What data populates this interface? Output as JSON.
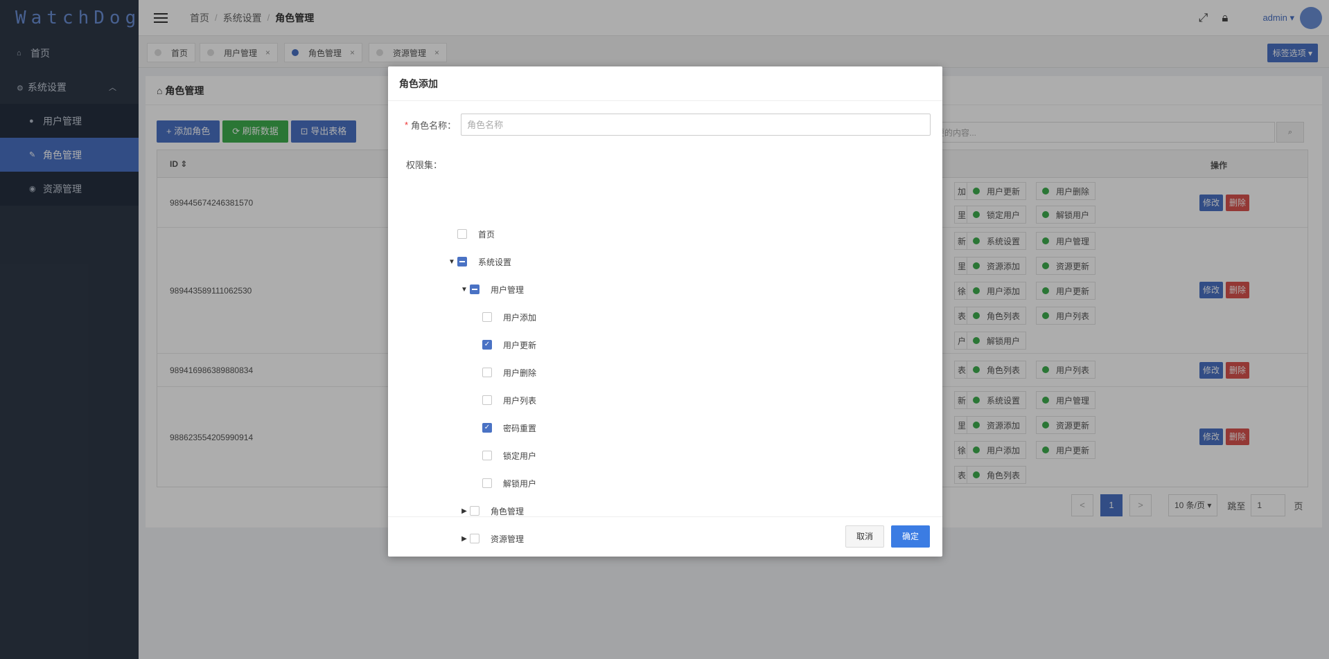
{
  "app": {
    "logo_text": "WatchDog"
  },
  "sidebar": {
    "items": [
      {
        "label": "首页"
      },
      {
        "label": "系统设置"
      },
      {
        "label": "用户管理"
      },
      {
        "label": "角色管理"
      },
      {
        "label": "资源管理"
      }
    ]
  },
  "header": {
    "breadcrumbs": [
      "首页",
      "系统设置",
      "角色管理"
    ],
    "user": "admin"
  },
  "tabs": [
    {
      "label": "首页"
    },
    {
      "label": "用户管理"
    },
    {
      "label": "角色管理"
    },
    {
      "label": "资源管理"
    }
  ],
  "tab_options_label": "标签选项",
  "panel": {
    "title": "角色管理",
    "add_label": "添加角色",
    "refresh_label": "刷新数据",
    "export_label": "导出表格",
    "search_placeholder": "要的内容...",
    "col_id": "ID",
    "col_ops": "操作",
    "rows": [
      {
        "id": "989445674246381570",
        "chips": [
          "加",
          "用户更新",
          "用户删除",
          "里",
          "锁定用户",
          "解锁用户"
        ]
      },
      {
        "id": "989443589111062530",
        "chips": [
          "新",
          "系统设置",
          "用户管理",
          "里",
          "资源添加",
          "资源更新",
          "徐",
          "用户添加",
          "用户更新",
          "表",
          "角色列表",
          "用户列表",
          "户",
          "解锁用户"
        ]
      },
      {
        "id": "989416986389880834",
        "chips": [
          "表",
          "角色列表",
          "用户列表"
        ]
      },
      {
        "id": "988623554205990914",
        "chips": [
          "新",
          "系统设置",
          "用户管理",
          "里",
          "资源添加",
          "资源更新",
          "徐",
          "用户添加",
          "用户更新",
          "表",
          "角色列表"
        ]
      }
    ],
    "edit_label": "修改",
    "delete_label": "删除"
  },
  "pager": {
    "prev": "<",
    "current": "1",
    "next": ">",
    "page_size": "10 条/页",
    "goto_label": "跳至",
    "goto_value": "1",
    "page_unit": "页"
  },
  "modal": {
    "title": "角色添加",
    "name_label": "角色名称：",
    "name_placeholder": "角色名称",
    "perm_label": "权限集：",
    "tree": {
      "home": "首页",
      "system": "系统设置",
      "user_mgmt": "用户管理",
      "user_add": "用户添加",
      "user_update": "用户更新",
      "user_delete": "用户删除",
      "user_list": "用户列表",
      "pwd_reset": "密码重置",
      "lock_user": "锁定用户",
      "unlock_user": "解锁用户",
      "role_mgmt": "角色管理",
      "res_mgmt": "资源管理"
    },
    "cancel_label": "取消",
    "ok_label": "确定"
  }
}
